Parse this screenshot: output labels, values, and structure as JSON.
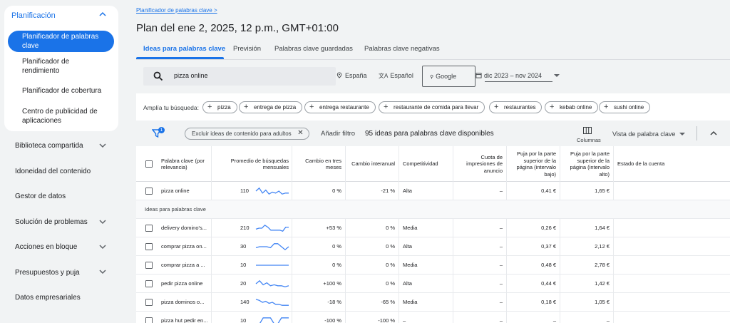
{
  "sidebar": {
    "section_open": "Planificación",
    "active_item": "Planificador de palabras clave",
    "sub_items": [
      "Planificador de rendimiento",
      "Planificador de cobertura",
      "Centro de publicidad de aplicaciones"
    ],
    "sections": [
      {
        "label": "Biblioteca compartida",
        "has_chevron": true
      },
      {
        "label": "Idoneidad del contenido",
        "has_chevron": false
      },
      {
        "label": "Gestor de datos",
        "has_chevron": false
      },
      {
        "label": "Solución de problemas",
        "has_chevron": true
      },
      {
        "label": "Acciones en bloque",
        "has_chevron": true
      },
      {
        "label": "Presupuestos y puja",
        "has_chevron": true
      },
      {
        "label": "Datos empresariales",
        "has_chevron": false
      }
    ]
  },
  "header": {
    "breadcrumb": "Planificador de palabras clave >",
    "title": "Plan del ene 2, 2025, 12 p.m., GMT+01:00",
    "tabs": [
      "Ideas para palabras clave",
      "Previsión",
      "Palabras clave guardadas",
      "Palabras clave negativas"
    ]
  },
  "search": {
    "query": "pizza online",
    "location": "España",
    "language": "Español",
    "network": "Google",
    "date_range": "dic 2023 – nov 2024"
  },
  "broaden": {
    "label": "Amplía tu búsqueda:",
    "chips": [
      "pizza",
      "entrega de pizza",
      "entrega restaurante",
      "restaurante de comida para llevar",
      "restaurantes",
      "kebab online",
      "sushi online"
    ]
  },
  "toolbar": {
    "filter_count": "1",
    "exclude_chip": "Excluir ideas de contenido para adultos",
    "add_filter": "Añadir filtro",
    "ideas_count": "95 ideas para palabras clave disponibles",
    "columns_label": "Columnas",
    "view_label": "Vista de palabra clave"
  },
  "table": {
    "headers": {
      "keyword": "Palabra clave (por relevancia)",
      "avg_searches": "Promedio de búsquedas mensuales",
      "three_month": "Cambio en tres meses",
      "yoy": "Cambio interanual",
      "competition": "Competitividad",
      "impression_share": "Cuota de impresiones de anuncio",
      "bid_low": "Puja por la parte superior de la página (intervalo bajo)",
      "bid_high": "Puja por la parte superior de la página (intervalo alto)",
      "account_status": "Estado de la cuenta"
    },
    "section_label": "Ideas para palabras clave",
    "provided": {
      "keyword": "pizza online",
      "avg": "110",
      "three_month": "0 %",
      "yoy": "-21 %",
      "competition": "Alta",
      "impression": "–",
      "bid_low": "0,41 €",
      "bid_high": "1,65 €",
      "trend": [
        0.5,
        0.8,
        0.3,
        0.6,
        0.2,
        0.4,
        0.3,
        0.5,
        0.2,
        0.3,
        0.3
      ]
    },
    "ideas": [
      {
        "keyword": "delivery domino's...",
        "avg": "210",
        "three_month": "+53 %",
        "yoy": "0 %",
        "competition": "Media",
        "impression": "–",
        "bid_low": "0,26 €",
        "bid_high": "1,64 €",
        "trend": [
          0.4,
          0.5,
          0.5,
          0.8,
          0.6,
          0.3,
          0.3,
          0.3,
          0.3,
          0.2,
          0.6,
          0.6
        ]
      },
      {
        "keyword": "comprar pizza on...",
        "avg": "30",
        "three_month": "0 %",
        "yoy": "0 %",
        "competition": "Alta",
        "impression": "–",
        "bid_low": "0,37 €",
        "bid_high": "2,12 €",
        "trend": [
          0.4,
          0.5,
          0.5,
          0.5,
          0.4,
          0.8,
          0.8,
          0.5,
          0.2,
          0.5
        ]
      },
      {
        "keyword": "comprar pizza a ...",
        "avg": "10",
        "three_month": "0 %",
        "yoy": "0 %",
        "competition": "Media",
        "impression": "–",
        "bid_low": "0,48 €",
        "bid_high": "2,78 €",
        "trend": [
          0.5,
          0.5,
          0.5,
          0.5,
          0.5,
          0.5,
          0.5,
          0.5,
          0.5,
          0.5
        ]
      },
      {
        "keyword": "pedir pizza online",
        "avg": "20",
        "three_month": "+100 %",
        "yoy": "0 %",
        "competition": "Alta",
        "impression": "–",
        "bid_low": "0,44 €",
        "bid_high": "1,42 €",
        "trend": [
          0.5,
          0.8,
          0.4,
          0.6,
          0.3,
          0.4,
          0.3,
          0.3,
          0.2,
          0.3
        ]
      },
      {
        "keyword": "pizza dominos o...",
        "avg": "140",
        "three_month": "-18 %",
        "yoy": "-65 %",
        "competition": "Media",
        "impression": "–",
        "bid_low": "0,18 €",
        "bid_high": "1,05 €",
        "trend": [
          0.8,
          0.7,
          0.5,
          0.6,
          0.4,
          0.5,
          0.3,
          0.3,
          0.2,
          0.2,
          0.2
        ]
      },
      {
        "keyword": "pizza hut pedir en...",
        "avg": "10",
        "three_month": "-100 %",
        "yoy": "-100 %",
        "competition": "–",
        "impression": "–",
        "bid_low": "–",
        "bid_high": "–",
        "trend": [
          0.2,
          0.2,
          0.8,
          0.8,
          0.8,
          0.2,
          0.2,
          0.8,
          0.8,
          0.8
        ]
      }
    ]
  },
  "colors": {
    "accent": "#1a73e8",
    "sparkline": "#4285f4",
    "background": "#f1f3f4"
  }
}
